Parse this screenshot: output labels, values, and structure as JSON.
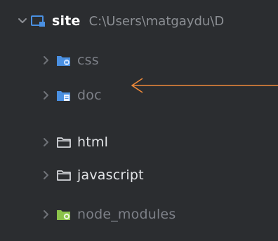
{
  "tree": {
    "root": {
      "label": "site",
      "path": "C:\\Users\\matgaydu\\D",
      "expanded": true
    },
    "children": [
      {
        "label": "css",
        "icon": "folder-stylesheet-icon",
        "dimmed": true
      },
      {
        "label": "doc",
        "icon": "folder-docs-icon",
        "dimmed": true
      },
      {
        "label": "html",
        "icon": "folder-outline-icon",
        "dimmed": false
      },
      {
        "label": "javascript",
        "icon": "folder-outline-icon",
        "dimmed": false
      },
      {
        "label": "node_modules",
        "icon": "folder-node-icon",
        "dimmed": true
      }
    ]
  },
  "colors": {
    "background": "#2b2d30",
    "accent_blue": "#4a90e2",
    "node_green": "#8bc34a",
    "annotation_arrow": "#f08a3a"
  }
}
